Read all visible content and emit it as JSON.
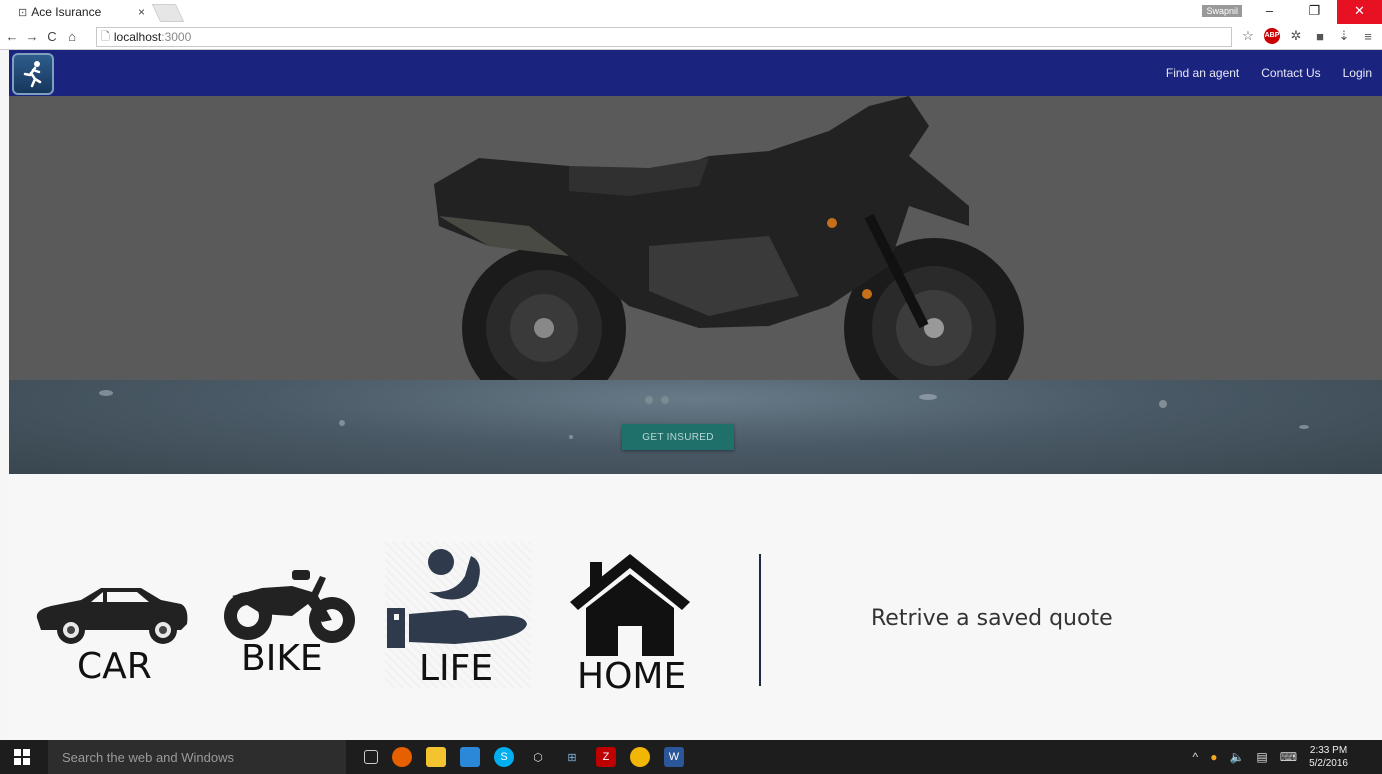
{
  "browser": {
    "tab_title": "Ace Isurance",
    "tab_close": "×",
    "url_host": "localhost",
    "url_port": ":3000",
    "user_badge": "Swapnil"
  },
  "nav": {
    "links": [
      "Find an agent",
      "Contact Us",
      "Login"
    ]
  },
  "hero": {
    "cta_label": "GET INSURED"
  },
  "products": {
    "items": [
      "CAR",
      "BIKE",
      "LIFE",
      "HOME"
    ],
    "retrieve_label": "Retrive a saved quote"
  },
  "taskbar": {
    "search_placeholder": "Search the web and Windows",
    "time": "2:33 PM",
    "date": "5/2/2016"
  },
  "colors": {
    "nav_bg": "#1a237e",
    "cta_bg": "#1f6f6a",
    "close_btn": "#e81123"
  },
  "icons": [
    "back-icon",
    "forward-icon",
    "reload-icon",
    "home-icon",
    "star-icon",
    "adblock-icon",
    "menu-icon",
    "car-icon",
    "bike-icon",
    "life-icon",
    "house-icon"
  ]
}
